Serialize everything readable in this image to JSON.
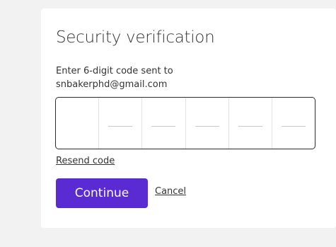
{
  "dialog": {
    "title": "Security verification",
    "instruction_line1": "Enter 6-digit code sent to",
    "instruction_line2": "snbakerphd@gmail.com"
  },
  "code_input": {
    "digit_count": 6,
    "values": [
      "",
      "",
      "",
      "",
      "",
      ""
    ]
  },
  "actions": {
    "resend_label": "Resend code",
    "continue_label": "Continue",
    "cancel_label": "Cancel"
  },
  "colors": {
    "accent": "#5a2ad2",
    "background": "#f2f2f2",
    "card": "#ffffff",
    "text": "#333333"
  }
}
